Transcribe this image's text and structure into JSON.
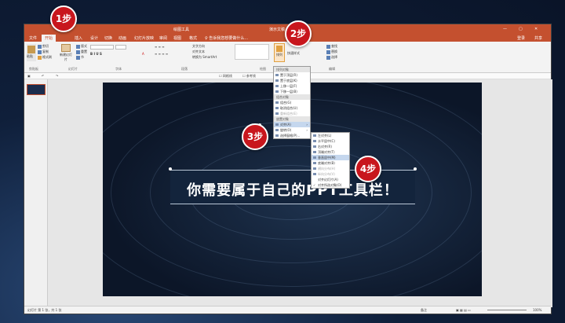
{
  "window": {
    "title": "演示文稿",
    "context_tool": "绘图工具",
    "search_placeholder": "告诉我您想要做什么...",
    "sign_in": "登录",
    "share": "共享"
  },
  "tabs": [
    "文件",
    "开始",
    "插入",
    "设计",
    "切换",
    "动画",
    "幻灯片放映",
    "审阅",
    "视图",
    "格式"
  ],
  "active_tab": "开始",
  "ribbon": {
    "groups": [
      "剪贴板",
      "幻灯片",
      "字体",
      "段落",
      "绘图",
      "编辑"
    ],
    "paste": "粘贴",
    "new_slide": "新建幻灯片",
    "arrange": "排列",
    "quick_styles": "快速样式",
    "find": "查找",
    "replace": "替换",
    "select": "选择",
    "text_direction": "文字方向",
    "align_text": "对齐文本",
    "smartart": "转换为 SmartArt"
  },
  "qat": {
    "check1": "网格线",
    "check2": "参考线"
  },
  "arrange_menu": {
    "sections": {
      "order": "排列对象",
      "group": "组合对象",
      "position": "放置对象"
    },
    "order_items": [
      "置于顶层(R)",
      "置于底层(K)",
      "上移一层(F)",
      "下移一层(B)"
    ],
    "group_items": [
      "组合(G)",
      "取消组合(U)",
      "重新组合(E)"
    ],
    "position_items": [
      "对齐(A)",
      "旋转(O)",
      "选择窗格(P)..."
    ]
  },
  "align_submenu": {
    "items": [
      "左对齐(L)",
      "水平居中(C)",
      "右对齐(R)",
      "顶端对齐(T)",
      "垂直居中(M)",
      "底端对齐(B)",
      "横向分布(H)",
      "纵向分布(V)",
      "对齐幻灯片(A)",
      "对齐所选对象(O)"
    ],
    "highlighted": "垂直居中(M)"
  },
  "slide": {
    "banner_text": "你需要属于自己的PPT工具栏！"
  },
  "status": {
    "left": "幻灯片 第 1 张，共 1 张",
    "notes": "备注",
    "zoom": "100%"
  },
  "callouts": [
    "1步",
    "2步",
    "3步",
    "4步"
  ],
  "colors": {
    "accent": "#c4502f",
    "callout": "#c8161d",
    "highlight": "#c5d7ee"
  }
}
